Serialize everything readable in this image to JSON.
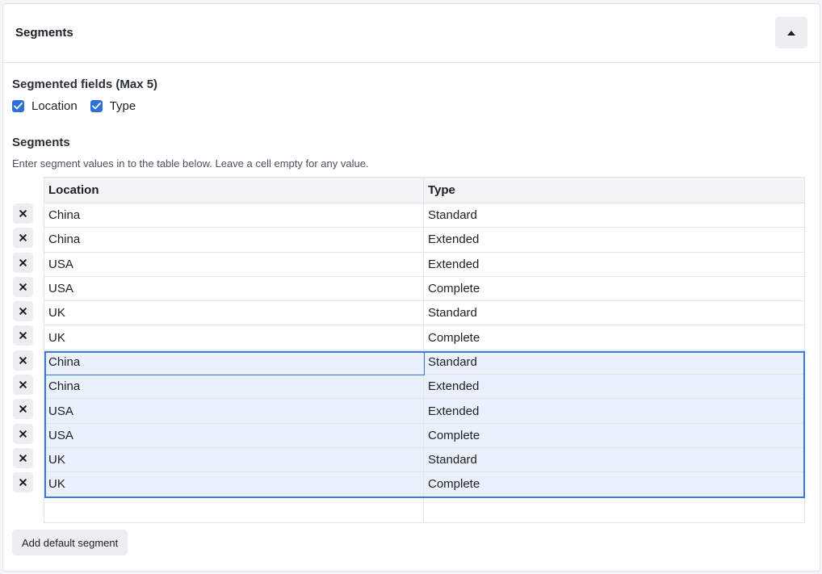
{
  "panel": {
    "title": "Segments"
  },
  "segmented_fields": {
    "label": "Segmented fields (Max 5)",
    "options": [
      {
        "label": "Location",
        "checked": true
      },
      {
        "label": "Type",
        "checked": true
      }
    ]
  },
  "segments": {
    "label": "Segments",
    "helper": "Enter segment values in to the table below. Leave a cell empty for any value.",
    "columns": [
      "Location",
      "Type"
    ],
    "rows": [
      [
        "China",
        "Standard"
      ],
      [
        "China",
        "Extended"
      ],
      [
        "USA",
        "Extended"
      ],
      [
        "USA",
        "Complete"
      ],
      [
        "UK",
        "Standard"
      ],
      [
        "UK",
        "Complete"
      ],
      [
        "China",
        "Standard"
      ],
      [
        "China",
        "Extended"
      ],
      [
        "USA",
        "Extended"
      ],
      [
        "USA",
        "Complete"
      ],
      [
        "UK",
        "Standard"
      ],
      [
        "UK",
        "Complete"
      ],
      [
        "",
        ""
      ]
    ],
    "selected_rows": [
      6,
      7,
      8,
      9,
      10,
      11
    ]
  },
  "actions": {
    "add_default_label": "Add default segment"
  },
  "colors": {
    "accent": "#2f6fd8",
    "selection": "#3b79dd",
    "selection_fill": "#ebf1fc"
  },
  "icons": {
    "collapse": "caret-up-icon",
    "delete": "close-icon",
    "check": "check-icon"
  }
}
